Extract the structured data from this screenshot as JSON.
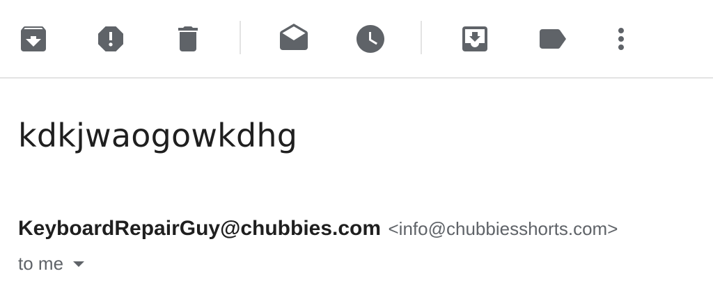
{
  "toolbar": {
    "icons": [
      "archive-icon",
      "report-spam-icon",
      "delete-icon",
      "mark-unread-icon",
      "snooze-icon",
      "move-to-inbox-icon",
      "label-icon",
      "more-vert-icon"
    ],
    "icon_color": "#5f6368"
  },
  "message": {
    "subject": "kdkjwaogowkdhg",
    "sender_name": "KeyboardRepairGuy@chubbies.com",
    "sender_email": "<info@chubbiesshorts.com>",
    "recipients_label": "to me"
  }
}
